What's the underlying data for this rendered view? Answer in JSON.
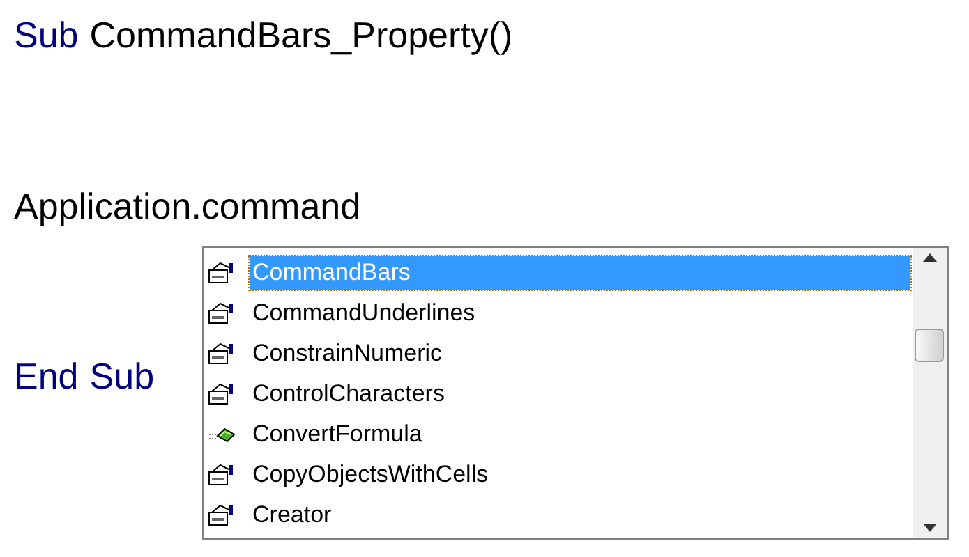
{
  "code_lines": [
    {
      "tokens": [
        {
          "kind": "keyword",
          "text": "Sub"
        },
        {
          "kind": "plain",
          "text": "CommandBars_Property()"
        }
      ]
    },
    {
      "tokens": [
        {
          "kind": "plain",
          "text": "Application.command"
        }
      ]
    },
    {
      "tokens": [
        {
          "kind": "keyword",
          "text": "End"
        },
        {
          "kind": "keyword",
          "text": "Sub"
        }
      ]
    }
  ],
  "completion_list": {
    "items": [
      {
        "kind": "property",
        "label": "CommandBars",
        "selected": true
      },
      {
        "kind": "property",
        "label": "CommandUnderlines",
        "selected": false
      },
      {
        "kind": "property",
        "label": "ConstrainNumeric",
        "selected": false
      },
      {
        "kind": "property",
        "label": "ControlCharacters",
        "selected": false
      },
      {
        "kind": "method",
        "label": "ConvertFormula",
        "selected": false
      },
      {
        "kind": "property",
        "label": "CopyObjectsWithCells",
        "selected": false
      },
      {
        "kind": "property",
        "label": "Creator",
        "selected": false
      }
    ]
  }
}
